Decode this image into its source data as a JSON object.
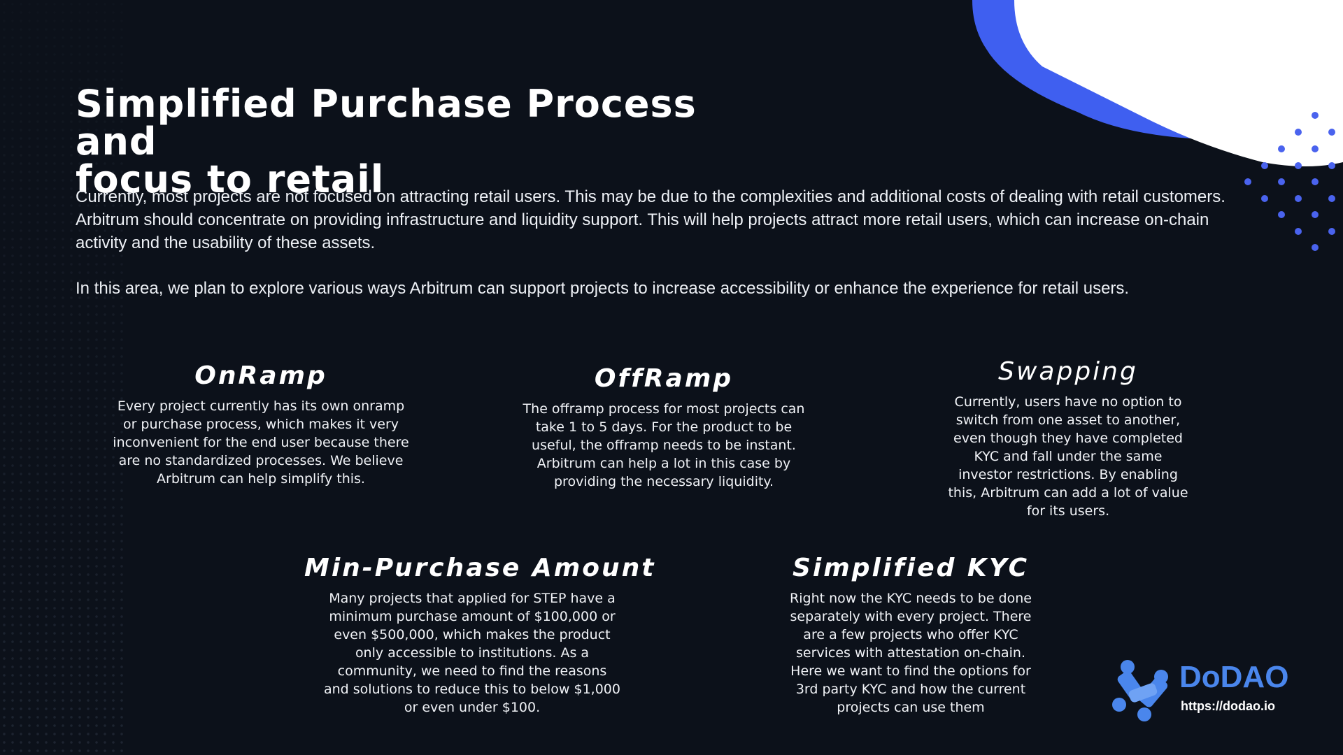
{
  "slide": {
    "title_line1": "Simplified Purchase Process and",
    "title_line2": "focus to retail",
    "paragraph1": "Currently, most projects are not focused on attracting retail users. This may be due to the complexities and additional costs of dealing with retail customers. Arbitrum should concentrate on providing infrastructure and liquidity support. This will help projects attract more retail users, which can increase on-chain activity and the usability of these assets.",
    "paragraph2": "In this area, we plan to explore various ways Arbitrum can support projects to increase accessibility or enhance the experience for retail users."
  },
  "cards": [
    {
      "title": "OnRamp",
      "body": "Every project currently has its own onramp or purchase process, which makes it very inconvenient for the end user because there are no standardized processes. We believe Arbitrum can help simplify this."
    },
    {
      "title": "OffRamp",
      "body": "The offramp process for most projects can take 1 to 5 days. For the product to be useful, the offramp needs to be instant. Arbitrum can help a lot in this case by providing the necessary liquidity."
    },
    {
      "title": "Swapping",
      "body": "Currently, users have no option to switch from one asset to another, even though they have completed KYC and fall under the same investor restrictions. By enabling this, Arbitrum can add a lot of value for its users."
    },
    {
      "title": "Min-Purchase Amount",
      "body": "Many projects that applied for STEP have a minimum purchase amount of $100,000 or even $500,000, which makes the product only accessible to institutions. As a community, we need to find the reasons and solutions to reduce this to below $1,000 or even under $100."
    },
    {
      "title": "Simplified KYC",
      "body": "Right now the KYC needs to be done separately with every project. There are a few projects who offer KYC services with attestation on-chain. Here we want to find the options for 3rd party KYC and how the current projects can use them"
    }
  ],
  "logo": {
    "name": "DoDAO",
    "url": "https://dodao.io",
    "icon": "dodao-logo-icon"
  },
  "colors": {
    "background": "#0c111a",
    "accent_blue": "#3f5ff0",
    "logo_blue": "#4a86ec",
    "text": "#ffffff"
  }
}
